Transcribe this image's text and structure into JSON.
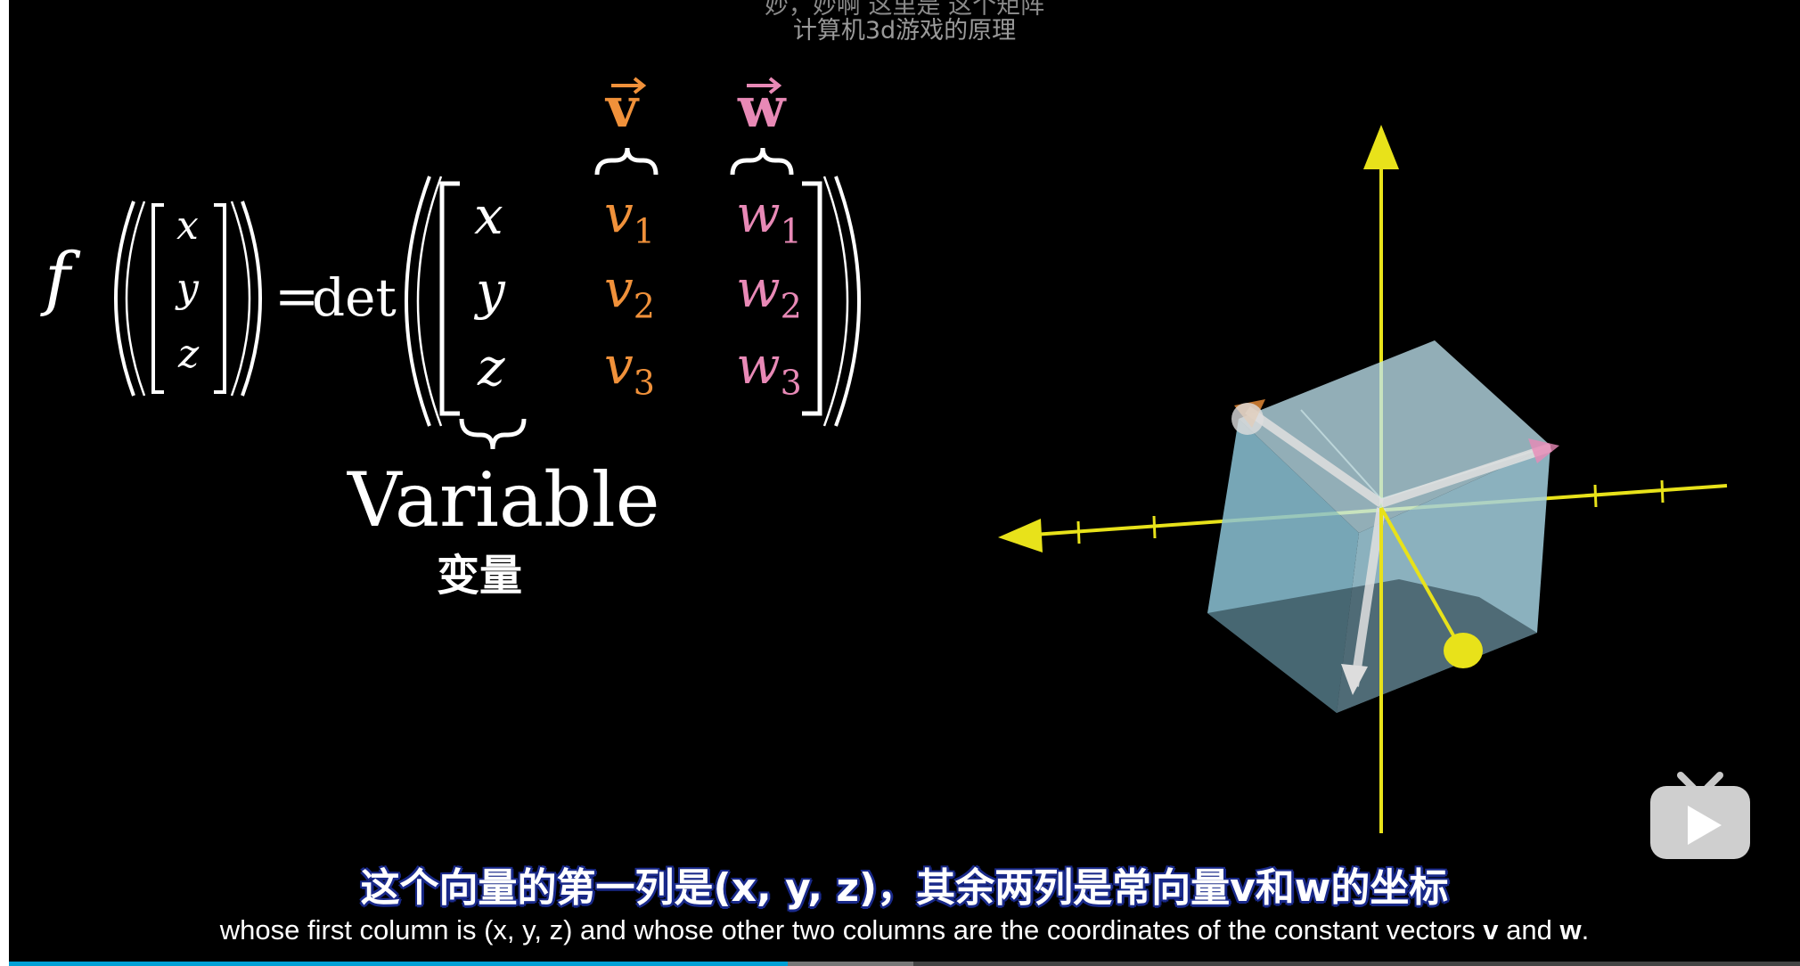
{
  "overlay": {
    "top_line_1": "妙，妙啊          这里是  这个矩阵",
    "top_line_2": "计算机3d游戏的原理"
  },
  "equation": {
    "func": "f",
    "equals": "=",
    "det": "det",
    "input_vector": [
      "x",
      "y",
      "z"
    ],
    "matrix_col1": [
      "x",
      "y",
      "z"
    ],
    "matrix_col2": [
      "v",
      "v",
      "v"
    ],
    "matrix_col3": [
      "w",
      "w",
      "w"
    ],
    "subscripts": [
      "1",
      "2",
      "3"
    ],
    "vector_v_label": "v",
    "vector_w_label": "w",
    "variable_label": "Variable",
    "variable_label_cn": "变量",
    "colors": {
      "v": "#f0913a",
      "w": "#e889b6",
      "text": "#ffffff"
    }
  },
  "scene": {
    "axis_color": "#e8e21a",
    "cube_color": "#a8d4e4"
  },
  "subtitles": {
    "cn": "这个向量的第一列是(x, y, z)，其余两列是常向量v和w的坐标",
    "en_prefix": "whose first column is (x, y, z) and whose other two columns are the coordinates of the constant vectors ",
    "en_v": "v",
    "en_and": " and ",
    "en_w": "w",
    "en_suffix": "."
  },
  "player": {
    "progress": 0.435,
    "buffered": 0.505,
    "play_icon": "bilibili-tv-play-icon"
  }
}
